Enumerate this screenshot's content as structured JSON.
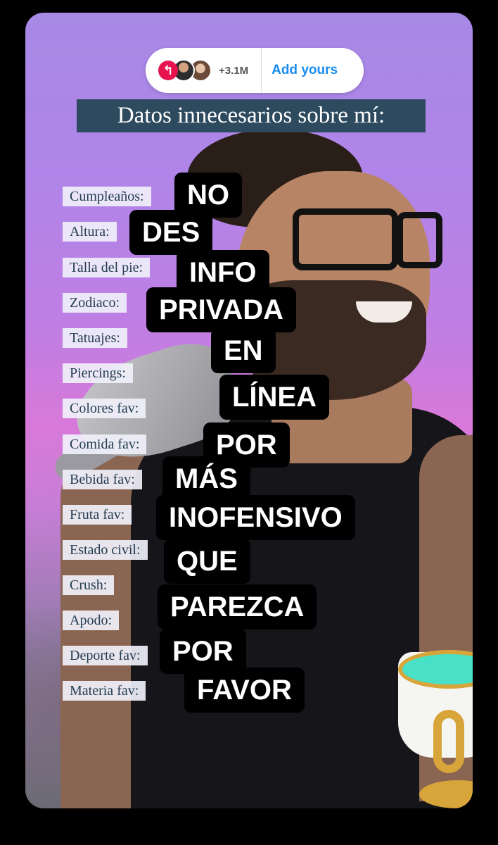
{
  "sticker": {
    "reply_icon": "↰",
    "participants": "+3.1M",
    "action_label": "Add yours"
  },
  "title": "Datos innecesarios sobre mí:",
  "labels": [
    "Cumpleaños:",
    "Altura:",
    "Talla del pie:",
    "Zodiaco:",
    "Tatuajes:",
    "Piercings:",
    "Colores fav:",
    "Comida fav:",
    "Bebida fav:",
    "Fruta fav:",
    "Estado civil:",
    "Crush:",
    "Apodo:",
    "Deporte fav:",
    "Materia fav:"
  ],
  "words": [
    "NO",
    "DES",
    "INFO",
    "PRIVADA",
    "EN",
    "LÍNEA",
    "POR",
    "MÁS",
    "INOFENSIVO",
    "QUE",
    "PAREZCA",
    "POR",
    "FAVOR"
  ],
  "colors": {
    "title_bg": "#2e4a5e",
    "label_text": "#243d52",
    "sticker_accent": "#1a8cf0",
    "reply_icon_bg": "#e6134f"
  }
}
